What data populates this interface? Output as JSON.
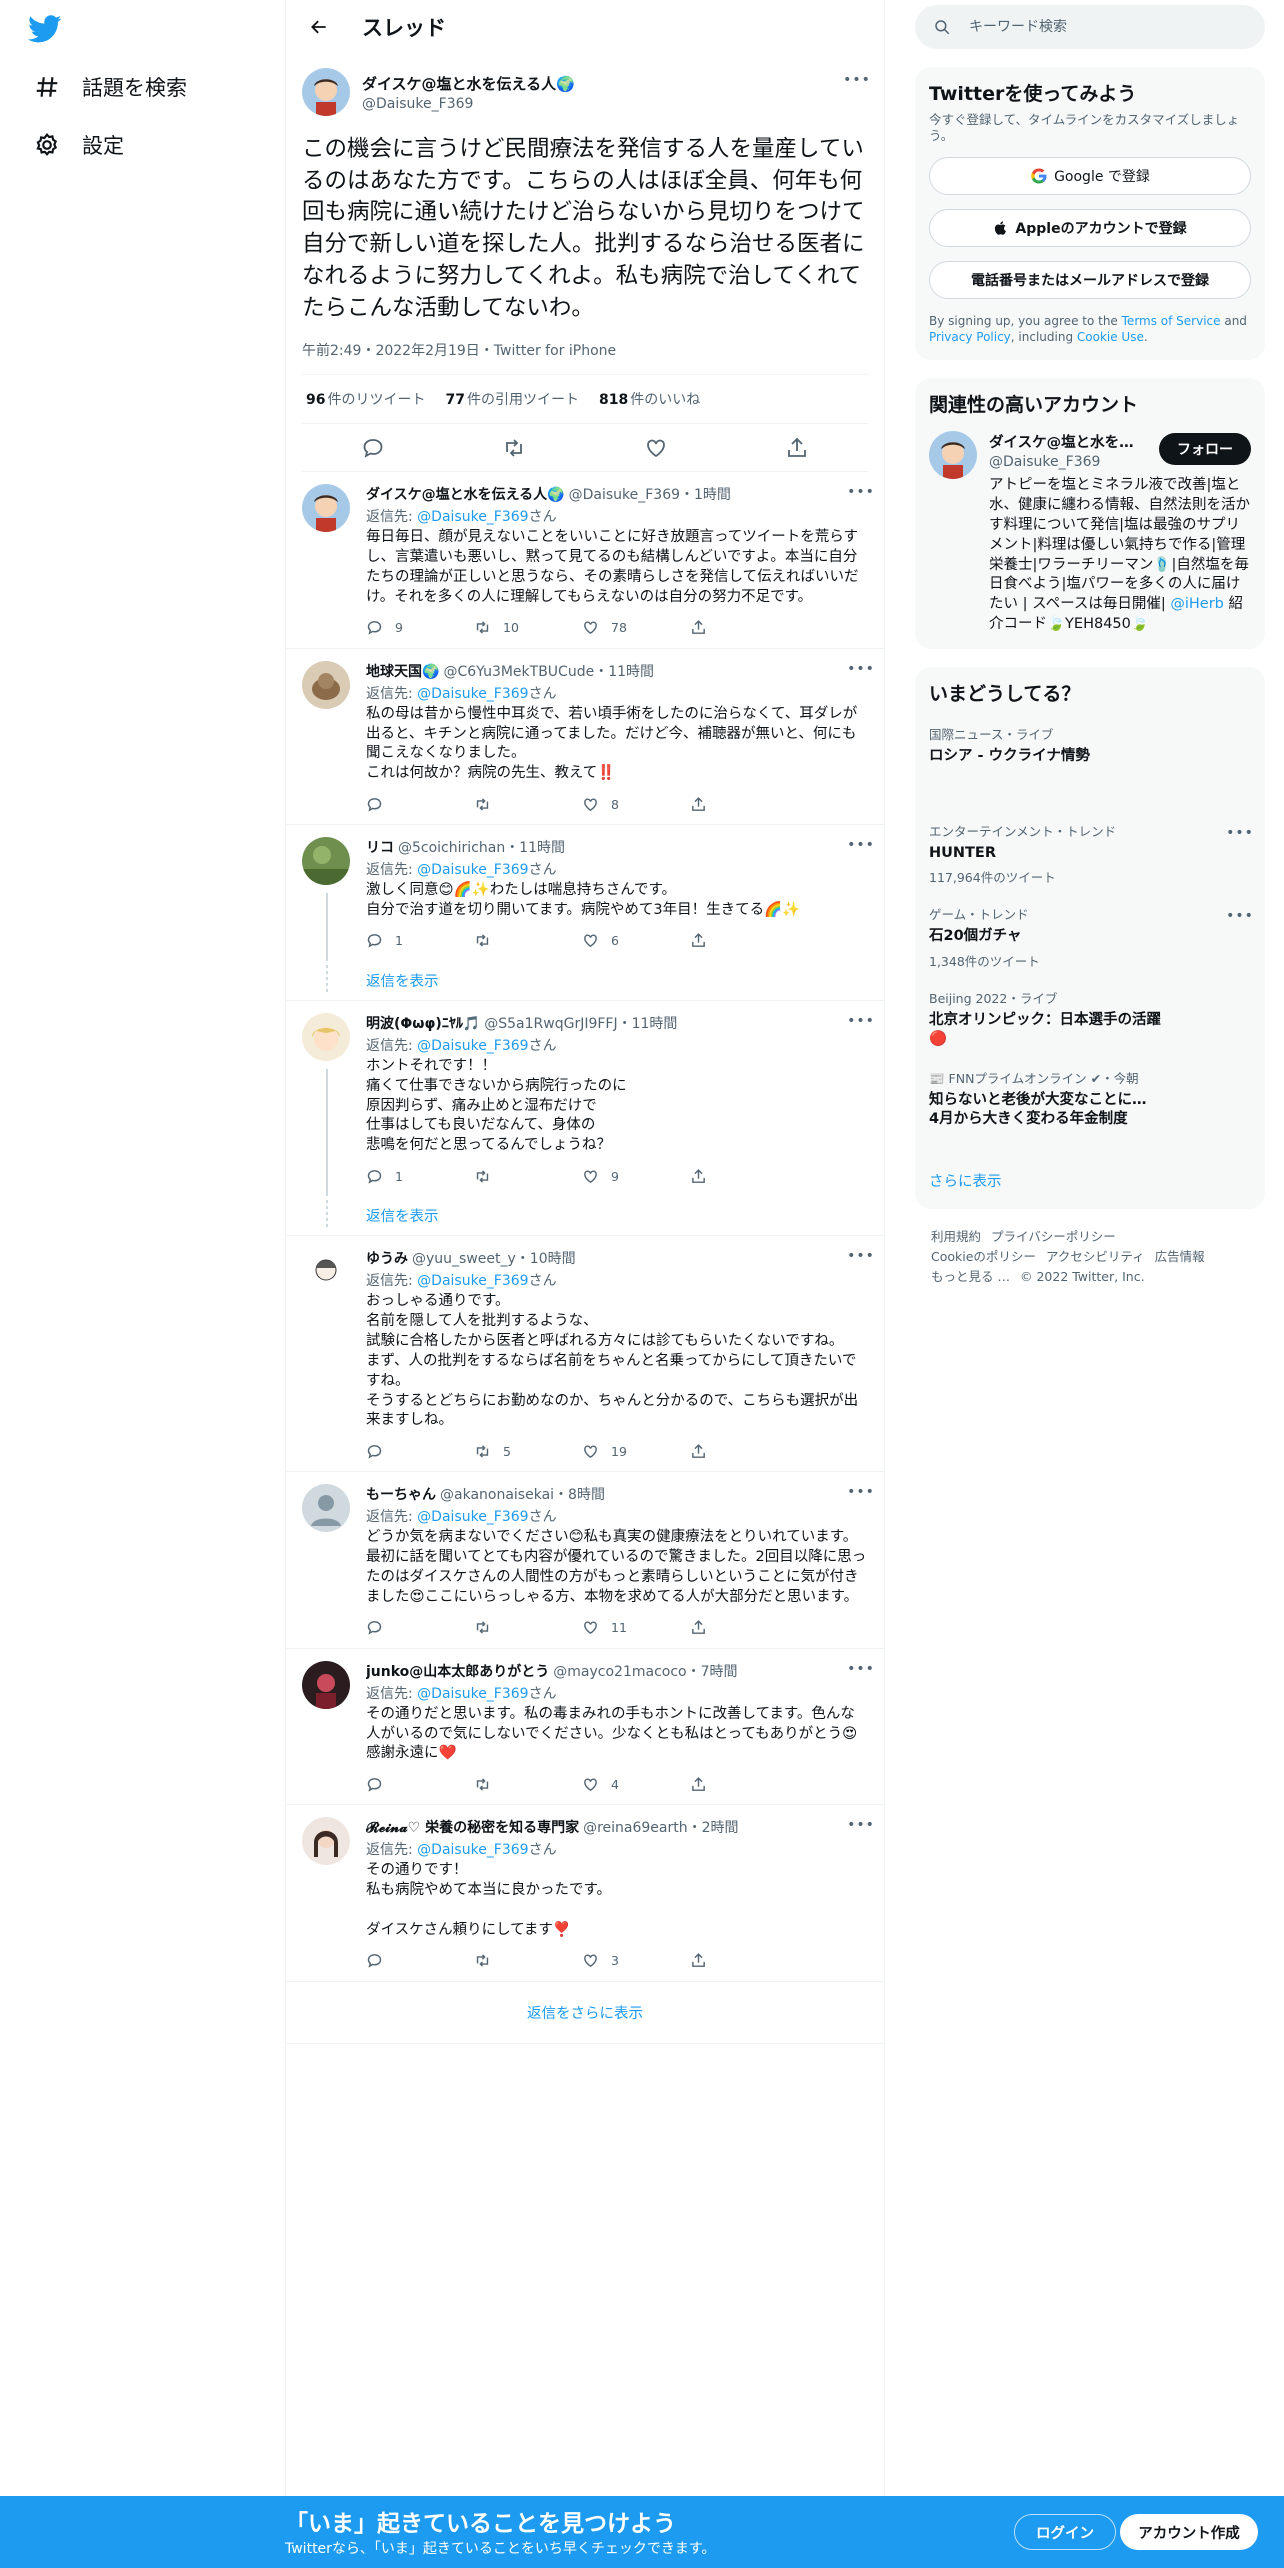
{
  "nav": {
    "items": [
      {
        "label": "話題を検索",
        "icon": "hashtag-icon"
      },
      {
        "label": "設定",
        "icon": "gear-icon"
      }
    ]
  },
  "header": {
    "title": "スレッド"
  },
  "focal_tweet": {
    "name": "ダイスケ@塩と水を伝える人🌍",
    "handle": "@Daisuke_F369",
    "text": "この機会に言うけど民間療法を発信する人を量産しているのはあなた方です。こちらの人はほぼ全員、何年も何回も病院に通い続けたけど治らないから見切りをつけて自分で新しい道を探した人。批判するなら治せる医者になれるように努力してくれよ。私も病院で治してくれてたらこんな活動してないわ。",
    "meta": "午前2:49・2022年2月19日・Twitter for iPhone",
    "retweets_count": "96",
    "retweets_label": "件のリツイート",
    "quotes_count": "77",
    "quotes_label": "件の引用ツイート",
    "likes_count": "818",
    "likes_label": "件のいいね"
  },
  "replies": [
    {
      "name": "ダイスケ@塩と水を伝える人🌍",
      "handle": "@Daisuke_F369",
      "time": "・1時間",
      "reply_to_prefix": "返信先: ",
      "reply_to_handle": "@Daisuke_F369",
      "reply_to_suffix": "さん",
      "text": "毎日毎日、顔が見えないことをいいことに好き放題言ってツイートを荒らすし、言葉遣いも悪いし、黙って見てるのも結構しんどいですよ。本当に自分たちの理論が正しいと思うなら、その素晴らしさを発信して伝えればいいだけ。それを多くの人に理解してもらえないのは自分の努力不足です。",
      "replies": "9",
      "retweets": "10",
      "likes": "78"
    },
    {
      "name": "地球天国🌍",
      "handle": "@C6Yu3MekTBUCude",
      "time": "・11時間",
      "reply_to_prefix": "返信先: ",
      "reply_to_handle": "@Daisuke_F369",
      "reply_to_suffix": "さん",
      "text": "私の母は昔から慢性中耳炎で、若い頃手術をしたのに治らなくて、耳ダレが出ると、キチンと病院に通ってました。だけど今、補聴器が無いと、何にも聞こえなくなりました。\nこれは何故か？病院の先生、教えて‼️",
      "replies": "",
      "retweets": "",
      "likes": "8"
    },
    {
      "name": "リコ",
      "handle": "@5coichirichan",
      "time": "・11時間",
      "reply_to_prefix": "返信先: ",
      "reply_to_handle": "@Daisuke_F369",
      "reply_to_suffix": "さん",
      "text": "激しく同意😊🌈✨わたしは喘息持ちさんです。\n自分で治す道を切り開いてます。病院やめて3年目！生きてる🌈✨",
      "replies": "1",
      "retweets": "",
      "likes": "6",
      "show_replies": "返信を表示"
    },
    {
      "name": "明波(Φωφ)ﾆﾔﾙ🎵",
      "handle": "@S5a1RwqGrJI9FFJ",
      "time": "・11時間",
      "reply_to_prefix": "返信先: ",
      "reply_to_handle": "@Daisuke_F369",
      "reply_to_suffix": "さん",
      "text": "ホントそれです！！\n痛くて仕事できないから病院行ったのに\n原因判らず、痛み止めと湿布だけで\n仕事はしても良いだなんて、身体の\n悲鳴を何だと思ってるんでしょうね？",
      "replies": "1",
      "retweets": "",
      "likes": "9",
      "show_replies": "返信を表示"
    },
    {
      "name": "ゆうみ",
      "handle": "@yuu_sweet_y",
      "time": "・10時間",
      "reply_to_prefix": "返信先: ",
      "reply_to_handle": "@Daisuke_F369",
      "reply_to_suffix": "さん",
      "text": "おっしゃる通りです。\n名前を隠して人を批判するような、\n試験に合格したから医者と呼ばれる方々には診てもらいたくないですね。\nまず、人の批判をするならば名前をちゃんと名乗ってからにして頂きたいですね。\nそうするとどちらにお勤めなのか、ちゃんと分かるので、こちらも選択が出来ますしね。",
      "replies": "",
      "retweets": "5",
      "likes": "19"
    },
    {
      "name": "もーちゃん",
      "handle": "@akanonaisekai",
      "time": "・8時間",
      "reply_to_prefix": "返信先: ",
      "reply_to_handle": "@Daisuke_F369",
      "reply_to_suffix": "さん",
      "text": "どうか気を病まないでください😊私も真実の健康療法をとりいれています。最初に話を聞いてとても内容が優れているので驚きました。2回目以降に思ったのはダイスケさんの人間性の方がもっと素晴らしいということに気が付きました😍ここにいらっしゃる方、本物を求めてる人が大部分だと思います。",
      "replies": "",
      "retweets": "",
      "likes": "11"
    },
    {
      "name": "junko@山本太郎ありがとう",
      "handle": "@mayco21macoco",
      "time": "・7時間",
      "reply_to_prefix": "返信先: ",
      "reply_to_handle": "@Daisuke_F369",
      "reply_to_suffix": "さん",
      "text": "その通りだと思います。私の毒まみれの手もホントに改善してます。色んな人がいるので気にしないでください。少なくとも私はとってもありがとう😍感謝永遠に❤️",
      "replies": "",
      "retweets": "",
      "likes": "4"
    },
    {
      "name": "𝓡𝓮𝓲𝓷𝓪♡ 栄養の秘密を知る専門家",
      "handle": "@reina69earth",
      "time": "・2時間",
      "reply_to_prefix": "返信先: ",
      "reply_to_handle": "@Daisuke_F369",
      "reply_to_suffix": "さん",
      "text": "その通りです！\n私も病院やめて本当に良かったです。\n\nダイスケさん頼りにしてます❣️",
      "replies": "",
      "retweets": "",
      "likes": "3"
    }
  ],
  "more_replies_label": "返信をさらに表示",
  "search": {
    "placeholder": "キーワード検索"
  },
  "signup_panel": {
    "title": "Twitterを使ってみよう",
    "subtitle": "今すぐ登録して、タイムラインをカスタマイズしましょう。",
    "google_label": "Google で登録",
    "apple_label": "Appleのアカウントで登録",
    "phone_label": "電話番号またはメールアドレスで登録",
    "terms_prefix": "By signing up, you agree to the ",
    "terms_link": "Terms of Service",
    "terms_and": " and ",
    "privacy_link": "Privacy Policy",
    "terms_including": ", including ",
    "cookie_link": "Cookie Use",
    "terms_end": "."
  },
  "related_panel": {
    "title": "関連性の高いアカウント",
    "account": {
      "name": "ダイスケ@塩と水を伝える人🌍",
      "handle": "@Daisuke_F369",
      "follow_label": "フォロー",
      "bio_before": "アトピーを塩とミネラル液で改善|塩と水、健康に纏わる情報、自然法則を活かす料理について発信|塩は最強のサプリメント|料理は優しい氣持ちで作る|管理栄養士|ワラーチリーマン🩴|自然塩を毎日食べよう|塩パワーを多くの人に届けたい | スペースは毎日開催| ",
      "bio_link": "@iHerb",
      "bio_after": " 紹介コード🍃YEH8450🍃"
    }
  },
  "trends_panel": {
    "title": "いまどうしてる？",
    "items": [
      {
        "category": "国際ニュース・ライブ",
        "title": "ロシア - ウクライナ情勢",
        "count": ""
      },
      {
        "category": "エンターテインメント・トレンド",
        "title": "HUNTER",
        "count": "117,964件のツイート"
      },
      {
        "category": "ゲーム・トレンド",
        "title": "石20個ガチャ",
        "count": "1,348件のツイート"
      },
      {
        "category": "Beijing 2022・ライブ",
        "title": "北京オリンピック：日本選手の活躍🔴",
        "count": ""
      },
      {
        "category": "📰 FNNプライムオンライン ✔・今朝",
        "title": "知らないと老後が大変なことに…\n4月から大きく変わる年金制度",
        "count": ""
      }
    ],
    "show_more": "さらに表示"
  },
  "footer": {
    "terms": "利用規約",
    "privacy": "プライバシーポリシー",
    "cookie": "Cookieのポリシー",
    "accessibility": "アクセシビリティ",
    "ads": "広告情報",
    "more": "もっと見る …",
    "copyright": "© 2022 Twitter, Inc."
  },
  "bottom_bar": {
    "title": "「いま」起きていることを見つけよう",
    "subtitle": "Twitterなら、「いま」起きていることをいち早くチェックできます。",
    "login_label": "ログイン",
    "signup_label": "アカウント作成"
  },
  "colors": {
    "accent": "#1d9bf0",
    "text": "#0f1419",
    "secondary": "#536471",
    "border": "#eff3f4"
  }
}
